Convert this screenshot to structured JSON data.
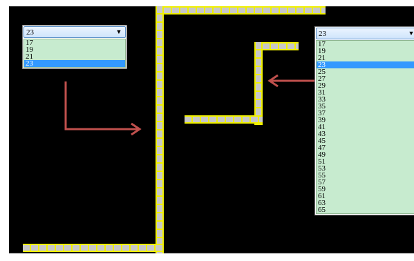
{
  "left_dropdown": {
    "selected_value": "23",
    "options": [
      "17",
      "19",
      "21",
      "23"
    ],
    "selected_index": 3
  },
  "right_dropdown": {
    "selected_value": "23",
    "options": [
      "17",
      "19",
      "21",
      "23",
      "25",
      "27",
      "29",
      "31",
      "33",
      "35",
      "37",
      "39",
      "41",
      "43",
      "45",
      "47",
      "49",
      "51",
      "53",
      "55",
      "57",
      "59",
      "61",
      "63",
      "65"
    ],
    "selected_index": 3
  },
  "icons": {
    "dropdown_arrow": "chevron-down-icon",
    "arrow_right": "arrow-right-icon",
    "arrow_left": "arrow-left-icon"
  },
  "colors": {
    "background": "#000000",
    "snake_fill": "#c8c8c8",
    "snake_border": "#f0f000",
    "list_background": "#c7ebcf",
    "selection": "#3399ff",
    "arrow": "#c0504d"
  }
}
